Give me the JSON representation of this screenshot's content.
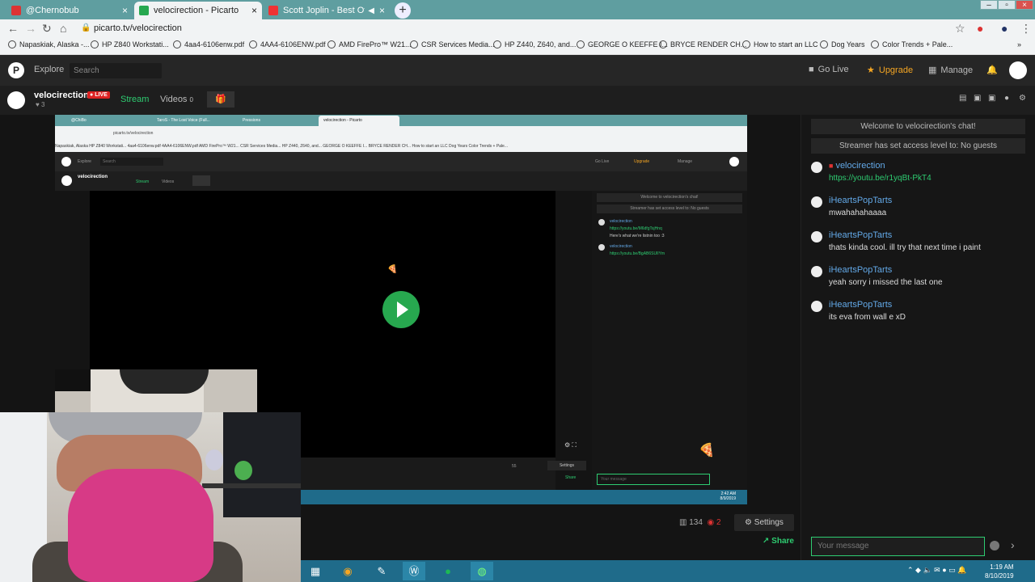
{
  "browser": {
    "tabs": [
      {
        "title": "@Chernobub",
        "fav_color": "#d33"
      },
      {
        "title": "velocirection - Picarto",
        "fav_color": "#27a84f"
      },
      {
        "title": "Scott Joplin - Best Of Scott J",
        "fav_color": "#e33"
      }
    ],
    "url": "picarto.tv/velocirection",
    "bookmarks": [
      "Napaskiak, Alaska -...",
      "HP Z840 Workstati...",
      "4aa4-6106enw.pdf",
      "4AA4-6106ENW.pdf",
      "AMD FirePro™ W21...",
      "CSR Services Media...",
      "HP Z440, Z640, and...",
      "GEORGE O KEEFFE I...",
      "BRYCE RENDER CH...",
      "How to start an LLC",
      "Dog Years",
      "Color Trends + Pale..."
    ]
  },
  "site": {
    "logo": "P",
    "explore": "Explore",
    "search_placeholder": "Search",
    "go_live": "Go Live",
    "upgrade": "Upgrade",
    "manage": "Manage"
  },
  "channel": {
    "name": "velocirection",
    "live_badge": "LIVE",
    "likes": "3",
    "tab_stream": "Stream",
    "tab_videos": "Videos",
    "videos_count": "0"
  },
  "chat": {
    "system_messages": [
      "Welcome to velocirection's chat!",
      "Streamer has set access level to: No guests"
    ],
    "messages": [
      {
        "user": "velocirection",
        "text": "https://youtu.be/r1yqBt-PkT4",
        "is_link": true
      },
      {
        "user": "iHeartsPopTarts",
        "text": "mwahahahaaaa",
        "is_link": false
      },
      {
        "user": "iHeartsPopTarts",
        "text": "thats kinda cool. ill try that next time i paint",
        "is_link": false
      },
      {
        "user": "iHeartsPopTarts",
        "text": "yeah sorry i missed the last one",
        "is_link": false
      },
      {
        "user": "iHeartsPopTarts",
        "text": "its eva from wall e xD",
        "is_link": false
      }
    ],
    "input_placeholder": "Your message"
  },
  "stage": {
    "viewers": "134",
    "eye_count": "2",
    "settings": "Settings",
    "share": "Share"
  },
  "capture": {
    "tabs": [
      "@ChiBo",
      "TaroS - The Lost Voice (Full...",
      "Pressions",
      "velocirection - Picarto"
    ],
    "url": "picarto.tv/velocirection",
    "bookmarks_line": "Napaskiak, Alaska   HP Z840 Workstati...   4aa4-6106enw.pdf   4AA4-6106ENW.pdf   AMD FirePro™ W21...   CSR Services Media...   HP Z440, Z640, and...   GEORGE O KEEFFE I...   BRYCE RENDER CH...   How to start an LLC   Dog Years   Color Trends + Pale...",
    "chan_name": "velocirection",
    "chat_sys": [
      "Welcome to velocirection's chat!",
      "Streamer has set access level to: No guests"
    ],
    "chat_msgs": [
      {
        "user": "velocirection",
        "link": "https://youtu.be/M6dfgTsjHnq",
        "text": "Here's what we're listnin too :3"
      },
      {
        "user": "velocirection",
        "link": "https://youtu.be/BgAB6SUlIYm",
        "text": ""
      }
    ],
    "input_placeholder": "Your message",
    "stats": "55",
    "settings": "Settings",
    "share": "Share",
    "clock_time": "2:42 AM",
    "clock_date": "8/9/2019"
  },
  "taskbar": {
    "time": "1:19 AM",
    "date": "8/10/2019"
  }
}
